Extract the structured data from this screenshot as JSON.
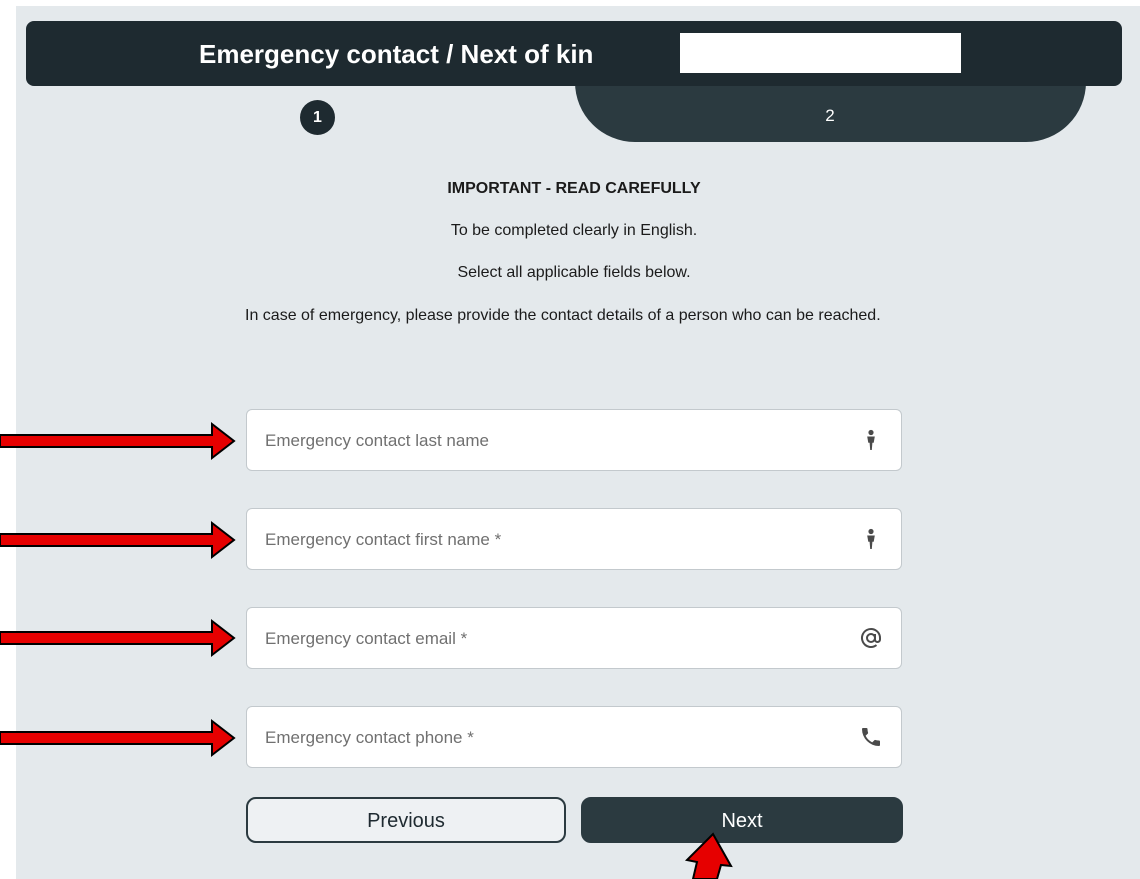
{
  "header": {
    "title": "Emergency contact / Next of kin"
  },
  "steps": {
    "step1": "1",
    "step2": "2"
  },
  "instructions": {
    "important": "IMPORTANT - READ CAREFULLY",
    "line1": "To be completed clearly in English.",
    "line2": "Select all applicable fields below.",
    "line3": "In case of emergency, please provide the contact details of a person who can be reached."
  },
  "fields": {
    "last_name": {
      "placeholder": "Emergency contact last name",
      "icon": "person-icon"
    },
    "first_name": {
      "placeholder": "Emergency contact first name *",
      "icon": "person-icon"
    },
    "email": {
      "placeholder": "Emergency contact email *",
      "icon": "at-sign-icon"
    },
    "phone": {
      "placeholder": "Emergency contact phone *",
      "icon": "phone-icon"
    }
  },
  "buttons": {
    "previous": "Previous",
    "next": "Next"
  },
  "colors": {
    "header_bg": "#1e2a30",
    "step_tab_bg": "#2b3a40",
    "panel_bg": "#e4e9ec",
    "annotation_arrow": "#e60000"
  }
}
